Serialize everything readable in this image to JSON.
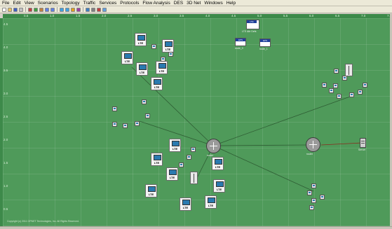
{
  "menu": [
    "File",
    "Edit",
    "View",
    "Scenarios",
    "Topology",
    "Traffic",
    "Services",
    "Protocols",
    "Flow Analysis",
    "DES",
    "3D Net",
    "Windows",
    "Help"
  ],
  "toolbar_icons": [
    "new-icon",
    "open-icon",
    "save-icon",
    "print-icon",
    "cut-icon",
    "copy-icon",
    "paste-icon",
    "zoom-in-icon",
    "zoom-out-icon",
    "run-icon",
    "results-icon",
    "graph-icon",
    "stats-icon",
    "table-icon",
    "link-icon",
    "palette-icon",
    "help-icon"
  ],
  "ruler": {
    "x_ticks": [
      "0.5",
      "1.0",
      "1.5",
      "2.0",
      "2.5",
      "3.0",
      "3.5",
      "4.0",
      "4.5",
      "5.0",
      "5.5",
      "6.0",
      "6.5",
      "7.0",
      "7.5"
    ],
    "y_ticks": [
      "0.5",
      "1.0",
      "1.5",
      "2.0",
      "2.5",
      "3.0",
      "3.5",
      "4.0",
      "4.5"
    ]
  },
  "node_text": "LTE",
  "config_node": {
    "title": "LTE",
    "label": "LTE Attr Defs"
  },
  "eps_nodes": [
    {
      "title": "EPS",
      "label": "node_0"
    },
    {
      "title": "EPS",
      "label": "node_1"
    }
  ],
  "router_label": "router",
  "server_label": "Server",
  "status_text": "Copyright (c) 2011 OPNET Technologies, Inc. All Rights Reserved.",
  "colors": {
    "workspace": "#4f9a5a",
    "ruler": "#3d8a4a",
    "link_green": "#2f5d34",
    "link_red": "#8a2a1e"
  }
}
